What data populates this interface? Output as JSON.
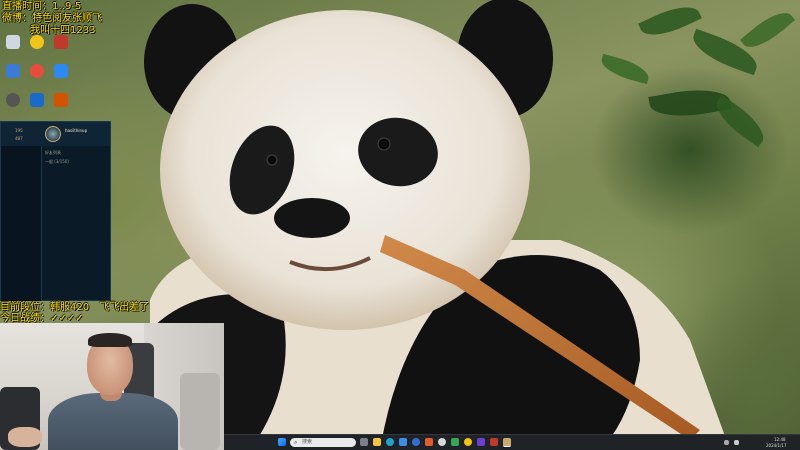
{
  "overlay": {
    "stream_time": "直播时间：1‥9-5",
    "weibo_line": "微博：特色阅友张顺飞",
    "name_line": "我叫十四1233",
    "rank_line": "目前段位：韩服420　飞飞出差了",
    "record_line": "今日战绩：✓✓✓✓"
  },
  "desktop_icons": [
    {
      "name": "recycle-bin-icon",
      "label": "",
      "color": "#cfd8e0"
    },
    {
      "name": "app-icon-1",
      "label": "",
      "color": "#f0c419"
    },
    {
      "name": "app-icon-2",
      "label": "",
      "color": "#c0392b"
    },
    {
      "name": "app-icon-3",
      "label": "",
      "color": "#3a7bd5"
    },
    {
      "name": "app-icon-4",
      "label": "",
      "color": "#e74c3c"
    },
    {
      "name": "app-icon-5",
      "label": "",
      "color": "#2d89ef"
    },
    {
      "name": "app-icon-6",
      "label": "",
      "color": "#555555"
    },
    {
      "name": "app-icon-7",
      "label": "",
      "color": "#1b6ac9"
    },
    {
      "name": "app-icon-8",
      "label": "",
      "color": "#d35400"
    }
  ],
  "client": {
    "stat1": "195",
    "stat2": "487",
    "username": "hasiithinup",
    "subtitle": "\"我的个性签名\"",
    "row1": "好友列表",
    "row2": "一般 (3/150)"
  },
  "taskbar": {
    "search_placeholder": "搜索",
    "clock_time": "12:48",
    "clock_date": "2024/1/17"
  },
  "colors": {
    "overlay_text": "#ffe200",
    "taskbar_bg": "#1f2226"
  }
}
